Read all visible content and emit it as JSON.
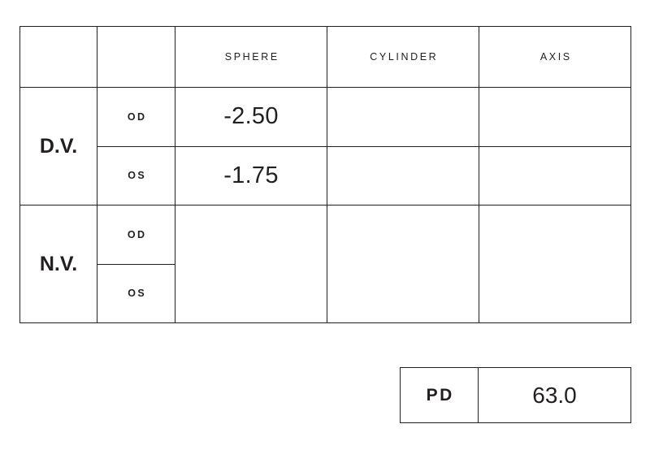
{
  "form": {
    "type": "eyeglass-prescription",
    "table": {
      "headers": {
        "corner": "",
        "eye_corner": "",
        "sphere": "SPHERE",
        "cylinder": "CYLINDER",
        "axis": "AXIS"
      },
      "sections": [
        {
          "label": "D.V.",
          "rows": [
            {
              "eye": "OD",
              "sphere": "-2.50",
              "cylinder": "",
              "axis": ""
            },
            {
              "eye": "OS",
              "sphere": "-1.75",
              "cylinder": "",
              "axis": ""
            }
          ]
        },
        {
          "label": "N.V.",
          "rows": [
            {
              "eye": "OD",
              "sphere": "",
              "cylinder": "",
              "axis": ""
            },
            {
              "eye": "OS",
              "sphere": "",
              "cylinder": "",
              "axis": ""
            }
          ]
        }
      ]
    },
    "pd": {
      "label": "PD",
      "value": "63.0"
    },
    "colors": {
      "ink": "#231f20",
      "border": "#231f20",
      "background": "#ffffff"
    }
  }
}
